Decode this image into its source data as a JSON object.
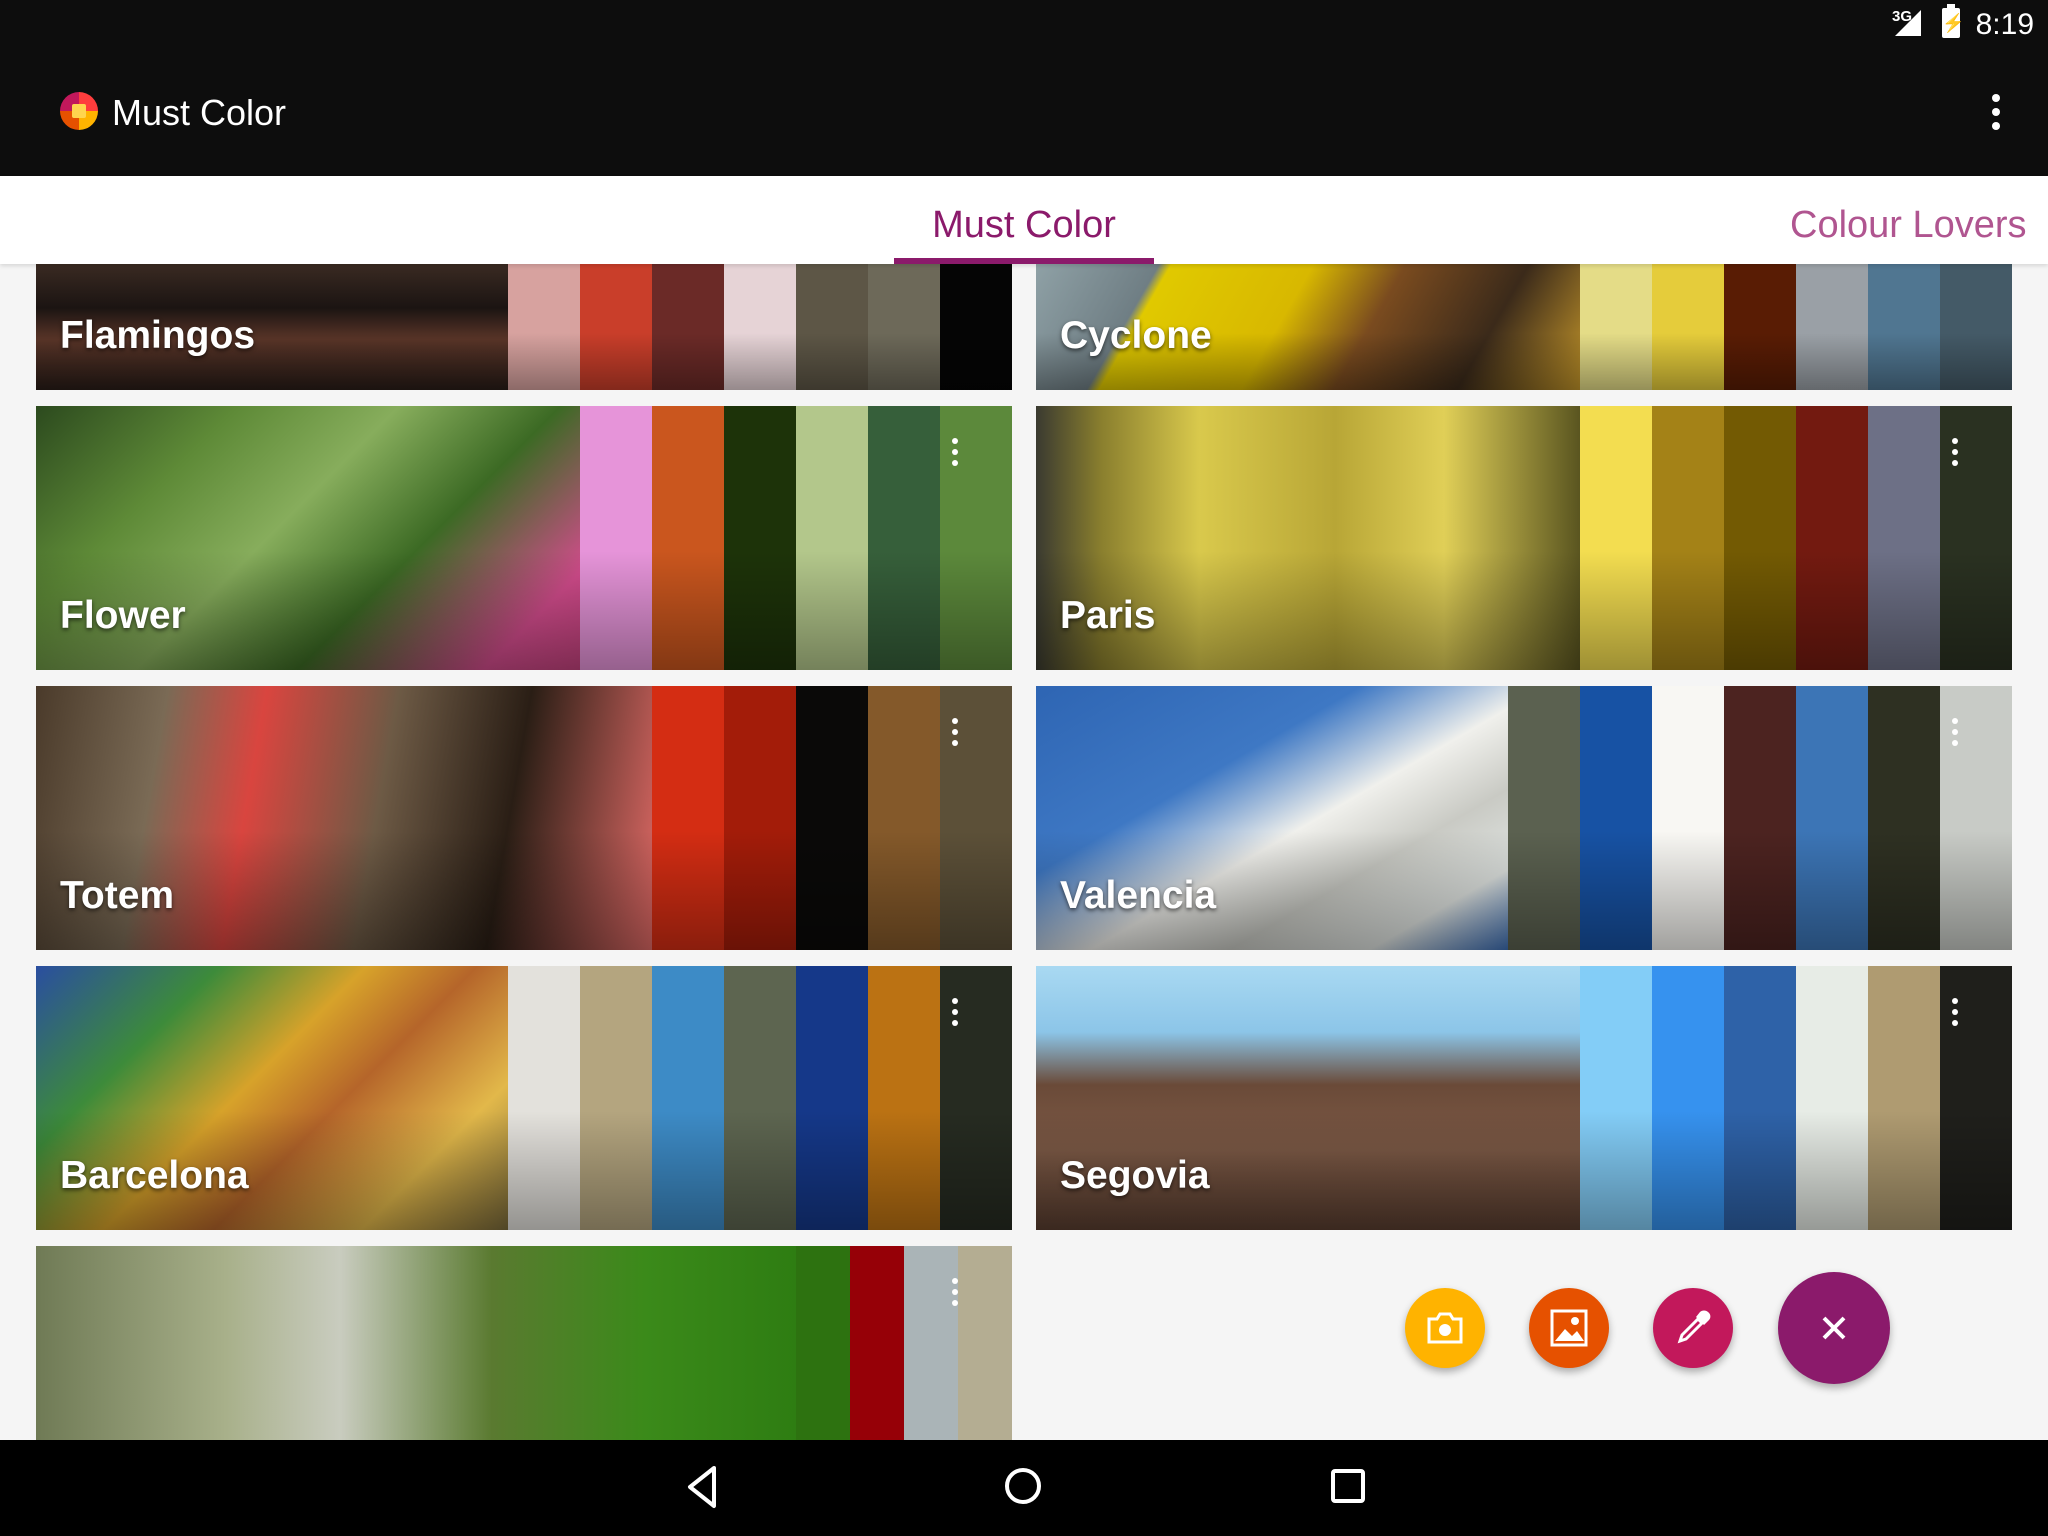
{
  "status_bar": {
    "network": "3G",
    "time": "8:19"
  },
  "app_bar": {
    "title": "Must Color"
  },
  "tabs": [
    {
      "label": "Must Color",
      "selected": true
    },
    {
      "label": "Colour Lovers",
      "selected": false
    }
  ],
  "theme": {
    "accent": "#8b1a6b",
    "tab_inactive": "#b05590"
  },
  "palettes": [
    {
      "name": "Flamingos",
      "photo": "linear-gradient(180deg,#3a2a22 0%,#1b1412 35%,#5a3528 60%,#2a1d18 100%)",
      "colors": [
        "#d7a29f",
        "#c93e2a",
        "#6b2a27",
        "#e6d3d6",
        "#5d5646",
        "#6d6959",
        "#050505"
      ]
    },
    {
      "name": "Cyclone",
      "photo": "linear-gradient(120deg,#8fa1a6 0%,#6f7e84 20%,#e0c900 22%,#d8b800 45%,#7a4b1f 60%,#3b2a1a 80%,#c4962a 100%)",
      "colors": [
        "#e4dc87",
        "#e5cc3b",
        "#591c04",
        "#9aa0a6",
        "#507691",
        "#445a67"
      ]
    },
    {
      "name": "Flower",
      "photo": "linear-gradient(135deg,#2c4a1e 0%,#5e8a37 25%,#87ad5c 45%,#3c6a24 65%,#d24c8c 88%,#c3427d 100%)",
      "colors": [
        "#e694d9",
        "#ca561e",
        "#1d3309",
        "#b3c78b",
        "#365f3a",
        "#5c893b"
      ]
    },
    {
      "name": "Paris",
      "photo": "linear-gradient(90deg,#3a3a30 0%,#8a7f2e 12%,#d9c94c 30%,#b8a636 55%,#e0cf57 75%,#5a5520 100%)",
      "colors": [
        "#f3dd50",
        "#a48217",
        "#735a03",
        "#731a10",
        "#6d7086",
        "#2a3121"
      ]
    },
    {
      "name": "Totem",
      "photo": "linear-gradient(100deg,#4a3a2a 0%,#7a6a55 20%,#d9453f 35%,#6d5a45 55%,#2a1e15 75%,#e06a66 100%)",
      "colors": [
        "#d42d13",
        "#a31c09",
        "#0a0908",
        "#84592a",
        "#5c5038"
      ]
    },
    {
      "name": "Valencia",
      "photo": "linear-gradient(150deg,#2e65b3 0%,#3e78c4 35%,#f0f0ec 55%,#c9cac4 70%,#dfe3e0 85%,#3d6fb6 100%)",
      "colors": [
        "#5b6150",
        "#1752a4",
        "#f8f7f3",
        "#4c2320",
        "#3c75b6",
        "#2e3022",
        "#c8cbc6"
      ]
    },
    {
      "name": "Barcelona",
      "photo": "linear-gradient(135deg,#2a4ea0 0%,#3d8b3a 25%,#d7a22a 45%,#b5652a 60%,#e2b84a 80%,#7a6a3a 100%)",
      "colors": [
        "#e3e1dc",
        "#b4a57f",
        "#3d8bc6",
        "#5d6550",
        "#153889",
        "#bb7213",
        "#262b21"
      ]
    },
    {
      "name": "Segovia",
      "photo": "linear-gradient(180deg,#a9d9f2 0%,#8cc5e8 25%,#6a4a38 45%,#7d5a46 70%,#5a3e30 100%)",
      "colors": [
        "#83cdf7",
        "#3692ef",
        "#2e62a8",
        "#e7ece6",
        "#af9b71",
        "#1f1f1b"
      ]
    },
    {
      "name": "",
      "photo": "linear-gradient(90deg,#6f7a55 0%,#a8b08a 25%,#c9ccbf 40%,#5a7a30 60%,#3b8a1a 80%,#2e7d12 100%)",
      "colors": [
        "#2d7210",
        "#960007",
        "#aab4b7",
        "#b4ad92"
      ]
    }
  ],
  "fabs": [
    {
      "name": "camera",
      "color": "#ffb300"
    },
    {
      "name": "gallery",
      "color": "#e65100"
    },
    {
      "name": "color-picker",
      "color": "#c2185b"
    },
    {
      "name": "close",
      "color": "#8b1a6b"
    }
  ]
}
